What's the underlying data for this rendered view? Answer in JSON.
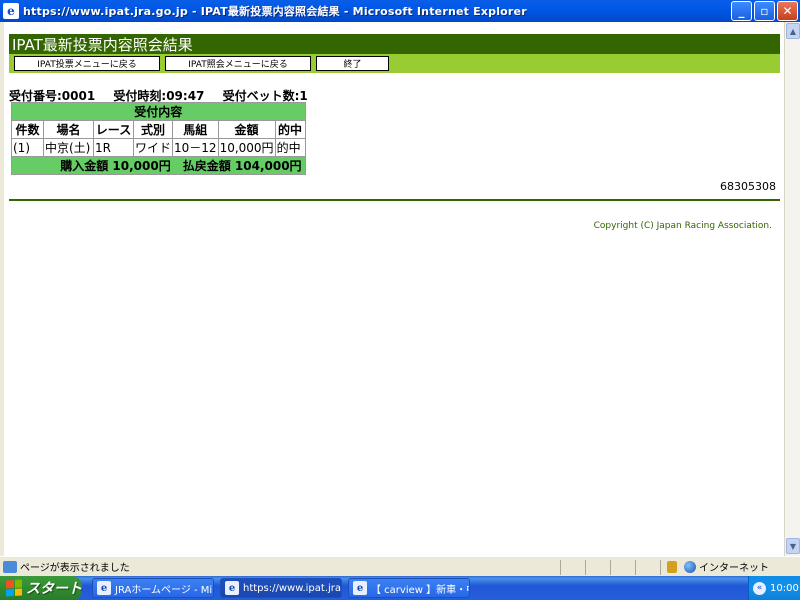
{
  "window": {
    "title": "https://www.ipat.jra.go.jp - IPAT最新投票内容照会結果 - Microsoft Internet Explorer",
    "app_icon": "e",
    "minimize": "_",
    "maximize": "▫",
    "close": "✕"
  },
  "page": {
    "header": "IPAT最新投票内容照会結果",
    "menu": {
      "bet_menu": "IPAT投票メニューに戻る",
      "inquiry_menu": "IPAT照会メニューに戻る",
      "exit": "終了"
    },
    "receipt": {
      "number": "受付番号:0001",
      "time": "受付時刻:09:47",
      "bet_count": "受付ベット数:1"
    },
    "table": {
      "caption": "受付内容",
      "headers": [
        "件数",
        "場名",
        "レース",
        "式別",
        "馬組",
        "金額",
        "的中"
      ],
      "rows": [
        [
          "(1)",
          "中京(土)",
          "1R",
          "ワイド",
          "10－12",
          "10,000円",
          "的中"
        ]
      ],
      "total": "購入金額 10,000円　払戻金額 104,000円"
    },
    "account_number": "68305308",
    "copyright": "Copyright (C) Japan Racing Association."
  },
  "statusbar": {
    "message": "ページが表示されました",
    "zone": "インターネット"
  },
  "taskbar": {
    "start": "スタート",
    "tasks": [
      {
        "label": "JRAホームページ - Mi...",
        "icon": "e"
      },
      {
        "label": "https://www.ipat.jra.g...",
        "icon": "e"
      },
      {
        "label": "【 carview 】新車・中...",
        "icon": "e"
      }
    ],
    "clock": "10:00"
  }
}
